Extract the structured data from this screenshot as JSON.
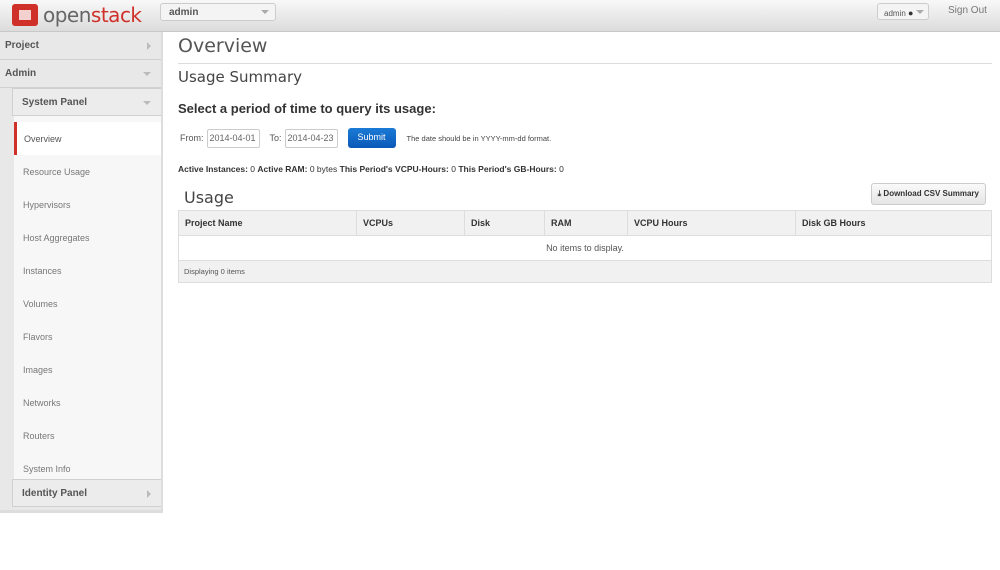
{
  "brand": {
    "logo_text_1": "open",
    "logo_text_2": "stack",
    "accent": "#d0302a"
  },
  "topbar": {
    "project_selector": "admin",
    "user_menu": "admin",
    "sign_out": "Sign Out"
  },
  "sidebar": {
    "project": "Project",
    "admin": "Admin",
    "system_panel": "System Panel",
    "identity_panel": "Identity Panel",
    "items": [
      {
        "label": "Overview",
        "active": true
      },
      {
        "label": "Resource Usage"
      },
      {
        "label": "Hypervisors"
      },
      {
        "label": "Host Aggregates"
      },
      {
        "label": "Instances"
      },
      {
        "label": "Volumes"
      },
      {
        "label": "Flavors"
      },
      {
        "label": "Images"
      },
      {
        "label": "Networks"
      },
      {
        "label": "Routers"
      },
      {
        "label": "System Info"
      }
    ]
  },
  "main": {
    "title": "Overview",
    "subtitle": "Usage Summary",
    "query_heading": "Select a period of time to query its usage:",
    "form": {
      "from_label": "From:",
      "from_value": "2014-04-01",
      "to_label": "To:",
      "to_value": "2014-04-23",
      "submit": "Submit",
      "hint": "The date should be in YYYY-mm-dd format."
    },
    "stats": {
      "instances_label": "Active Instances:",
      "instances": "0",
      "ram_label": "Active RAM:",
      "ram": "0 bytes",
      "vcpu_label": "This Period's VCPU-Hours:",
      "vcpu": "0",
      "gb_label": "This Period's GB-Hours:",
      "gb": "0"
    },
    "usage": {
      "title": "Usage",
      "download": "Download CSV Summary",
      "columns": [
        "Project Name",
        "VCPUs",
        "Disk",
        "RAM",
        "VCPU Hours",
        "Disk GB Hours"
      ],
      "empty": "No items to display.",
      "footer": "Displaying 0 items"
    }
  }
}
